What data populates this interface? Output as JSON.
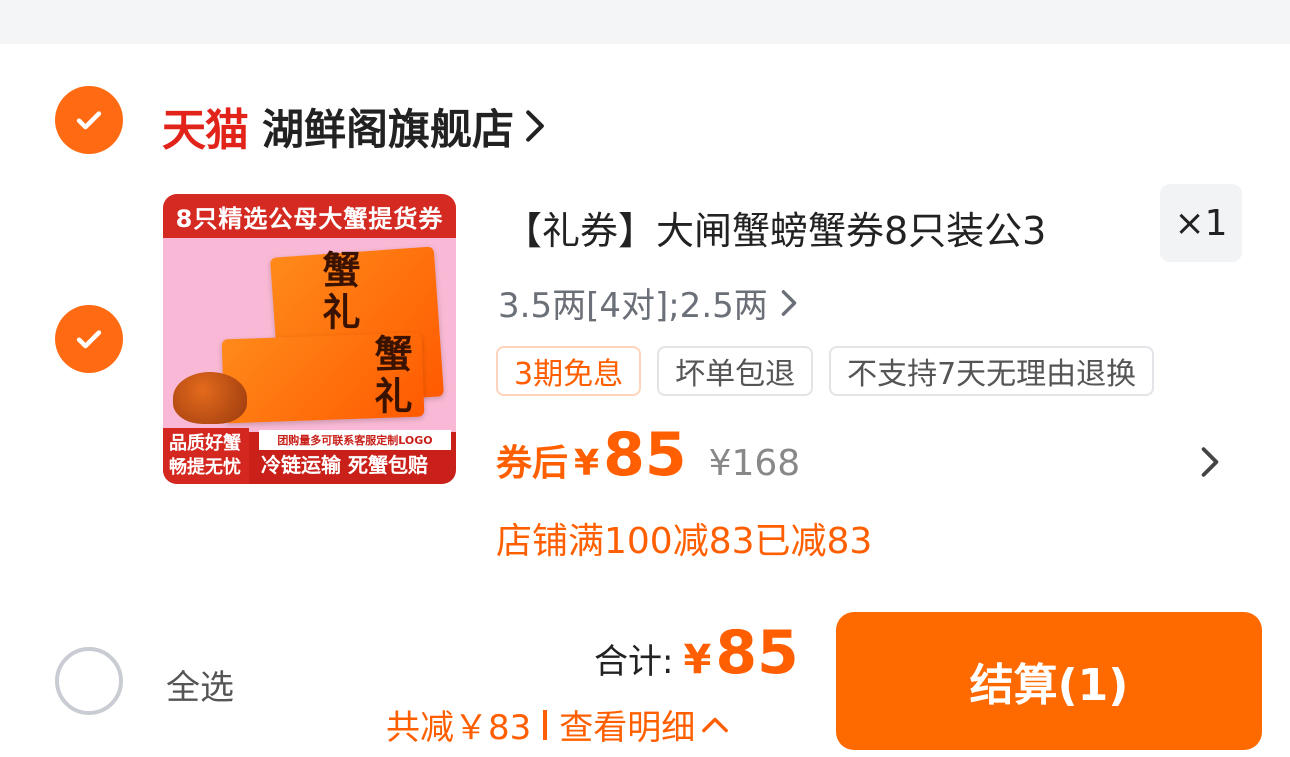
{
  "shop": {
    "brand": "天猫",
    "name": "湖鲜阁旗舰店"
  },
  "product": {
    "image_texts": {
      "banner": "8只精选公母大蟹提货券",
      "envelope_1": "蟹礼",
      "envelope_2": "蟹礼",
      "side_badge": "品质好蟹 畅提无忧",
      "note": "团购量多可联系客服定制LOGO",
      "slogan": "冷链运输 死蟹包赔"
    },
    "title": "【礼券】大闸蟹螃蟹券8只装公3",
    "quantity": "×1",
    "spec": "3.5两[4对];2.5两",
    "tags": [
      "3期免息",
      "坏单包退",
      "不支持7天无理由退换"
    ],
    "price_label": "券后",
    "currency": "¥",
    "price": "85",
    "original_price": "¥168",
    "promo": "店铺满100减83已减83"
  },
  "footer": {
    "select_all": "全选",
    "total_label": "合计:",
    "total_currency": "¥",
    "total_value": "85",
    "savings_text": "共减￥83",
    "details_text": "查看明细",
    "checkout_label": "结算(1)"
  },
  "colors": {
    "accent": "#ff6a00",
    "tmall_red": "#e2231a",
    "page_bg": "#f4f5f7"
  },
  "icons": {
    "shop_check": "check-circle-filled",
    "item_check": "check-circle-filled",
    "select_all": "circle-empty",
    "shop_arrow": "chevron-right",
    "spec_arrow": "chevron-right",
    "price_arrow": "chevron-right",
    "details_arrow": "chevron-up"
  }
}
